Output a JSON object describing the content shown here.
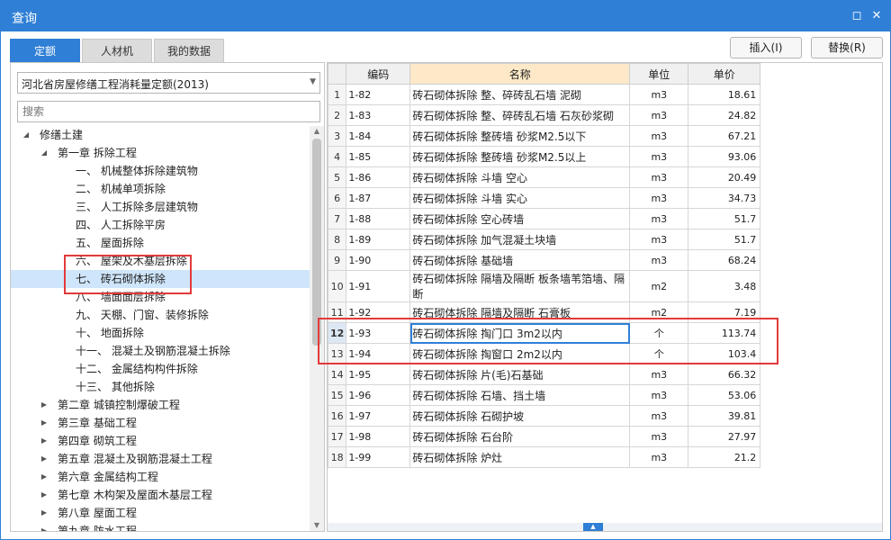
{
  "window": {
    "title": "查询"
  },
  "tabs": [
    "定额",
    "人材机",
    "我的数据"
  ],
  "buttons": {
    "insert": "插入(I)",
    "replace": "替换(R)"
  },
  "left": {
    "combo_value": "河北省房屋修缮工程消耗量定额(2013)",
    "search_placeholder": "搜索",
    "tree": [
      {
        "label": "修缮土建",
        "level": 0,
        "toggle": "◢"
      },
      {
        "label": "第一章 拆除工程",
        "level": 1,
        "toggle": "◢"
      },
      {
        "label": "一、 机械整体拆除建筑物",
        "level": 2,
        "toggle": ""
      },
      {
        "label": "二、 机械单项拆除",
        "level": 2,
        "toggle": ""
      },
      {
        "label": "三、 人工拆除多层建筑物",
        "level": 2,
        "toggle": ""
      },
      {
        "label": "四、 人工拆除平房",
        "level": 2,
        "toggle": ""
      },
      {
        "label": "五、 屋面拆除",
        "level": 2,
        "toggle": ""
      },
      {
        "label": "六、 屋架及木基层拆除",
        "level": 2,
        "toggle": ""
      },
      {
        "label": "七、 砖石砌体拆除",
        "level": 2,
        "toggle": "",
        "selected": true
      },
      {
        "label": "八、 墙面面层拆除",
        "level": 2,
        "toggle": ""
      },
      {
        "label": "九、 天棚、门窗、装修拆除",
        "level": 2,
        "toggle": ""
      },
      {
        "label": "十、 地面拆除",
        "level": 2,
        "toggle": ""
      },
      {
        "label": "十一、 混凝土及钢筋混凝土拆除",
        "level": 2,
        "toggle": ""
      },
      {
        "label": "十二、 金属结构构件拆除",
        "level": 2,
        "toggle": ""
      },
      {
        "label": "十三、 其他拆除",
        "level": 2,
        "toggle": ""
      },
      {
        "label": "第二章 城镇控制爆破工程",
        "level": 1,
        "toggle": "▶"
      },
      {
        "label": "第三章 基础工程",
        "level": 1,
        "toggle": "▶"
      },
      {
        "label": "第四章 砌筑工程",
        "level": 1,
        "toggle": "▶"
      },
      {
        "label": "第五章 混凝土及钢筋混凝土工程",
        "level": 1,
        "toggle": "▶"
      },
      {
        "label": "第六章 金属结构工程",
        "level": 1,
        "toggle": "▶"
      },
      {
        "label": "第七章 木构架及屋面木基层工程",
        "level": 1,
        "toggle": "▶"
      },
      {
        "label": "第八章 屋面工程",
        "level": 1,
        "toggle": "▶"
      },
      {
        "label": "第九章 防水工程",
        "level": 1,
        "toggle": "▶"
      }
    ]
  },
  "grid": {
    "headers": [
      "",
      "编码",
      "名称",
      "单位",
      "单价"
    ],
    "rows": [
      {
        "n": "1",
        "code": "1-82",
        "name": "砖石砌体拆除 整、碎砖乱石墙 泥砌",
        "unit": "m3",
        "price": "18.61"
      },
      {
        "n": "2",
        "code": "1-83",
        "name": "砖石砌体拆除 整、碎砖乱石墙 石灰砂浆砌",
        "unit": "m3",
        "price": "24.82"
      },
      {
        "n": "3",
        "code": "1-84",
        "name": "砖石砌体拆除 整砖墙 砂浆M2.5以下",
        "unit": "m3",
        "price": "67.21"
      },
      {
        "n": "4",
        "code": "1-85",
        "name": "砖石砌体拆除 整砖墙 砂浆M2.5以上",
        "unit": "m3",
        "price": "93.06"
      },
      {
        "n": "5",
        "code": "1-86",
        "name": "砖石砌体拆除 斗墙 空心",
        "unit": "m3",
        "price": "20.49"
      },
      {
        "n": "6",
        "code": "1-87",
        "name": "砖石砌体拆除 斗墙 实心",
        "unit": "m3",
        "price": "34.73"
      },
      {
        "n": "7",
        "code": "1-88",
        "name": "砖石砌体拆除 空心砖墙",
        "unit": "m3",
        "price": "51.7"
      },
      {
        "n": "8",
        "code": "1-89",
        "name": "砖石砌体拆除 加气混凝土块墙",
        "unit": "m3",
        "price": "51.7"
      },
      {
        "n": "9",
        "code": "1-90",
        "name": "砖石砌体拆除 基础墙",
        "unit": "m3",
        "price": "68.24"
      },
      {
        "n": "10",
        "code": "1-91",
        "name": "砖石砌体拆除 隔墙及隔断 板条墙苇箔墙、隔断",
        "unit": "m2",
        "price": "3.48",
        "tall": true
      },
      {
        "n": "11",
        "code": "1-92",
        "name": "砖石砌体拆除 隔墙及隔断 石膏板",
        "unit": "m2",
        "price": "7.19"
      },
      {
        "n": "12",
        "code": "1-93",
        "name": "砖石砌体拆除 掏门口 3m2以内",
        "unit": "个",
        "price": "113.74",
        "current": true
      },
      {
        "n": "13",
        "code": "1-94",
        "name": "砖石砌体拆除 掏窗口 2m2以内",
        "unit": "个",
        "price": "103.4"
      },
      {
        "n": "14",
        "code": "1-95",
        "name": "砖石砌体拆除 片(毛)石基础",
        "unit": "m3",
        "price": "66.32"
      },
      {
        "n": "15",
        "code": "1-96",
        "name": "砖石砌体拆除 石墙、挡土墙",
        "unit": "m3",
        "price": "53.06"
      },
      {
        "n": "16",
        "code": "1-97",
        "name": "砖石砌体拆除 石砌护坡",
        "unit": "m3",
        "price": "39.81"
      },
      {
        "n": "17",
        "code": "1-98",
        "name": "砖石砌体拆除 石台阶",
        "unit": "m3",
        "price": "27.97"
      },
      {
        "n": "18",
        "code": "1-99",
        "name": "砖石砌体拆除 炉灶",
        "unit": "m3",
        "price": "21.2"
      }
    ]
  },
  "colors": {
    "accent": "#2f7fd6",
    "highlight": "#e23a3a",
    "name_header": "#fde9c8",
    "tree_selected": "#cfe5fb"
  }
}
